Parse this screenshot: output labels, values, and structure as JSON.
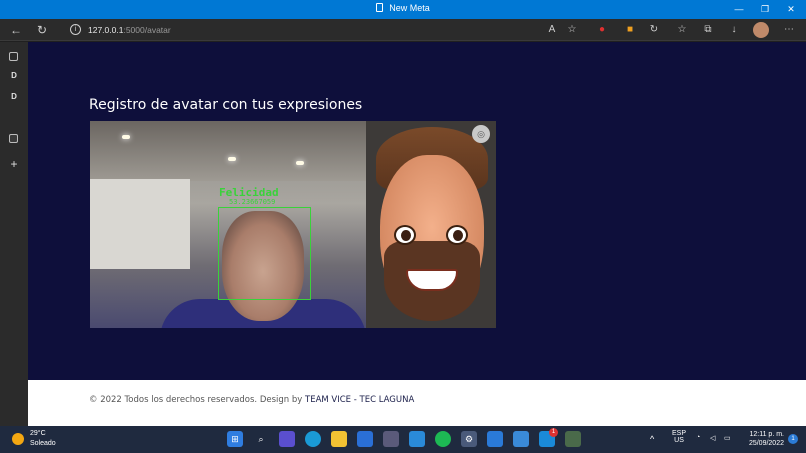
{
  "window": {
    "title": "New Meta",
    "minimize": "—",
    "maximize": "❐",
    "close": "✕"
  },
  "browser": {
    "url_host": "127.0.0.1",
    "url_path": ":5000/avatar",
    "back": "←",
    "refresh": "↻",
    "info": "i"
  },
  "sidebar": {
    "items": [
      {
        "label": "D"
      },
      {
        "label": "D"
      },
      {
        "label": "+"
      }
    ]
  },
  "page": {
    "title": "Registro de avatar con tus expresiones",
    "detection": {
      "emotion": "Felicidad",
      "confidence": "53.23667059"
    },
    "footer": {
      "text": "© 2022 Todos los derechos reservados. Design by ",
      "brand": "TEAM VICE - TEC LAGUNA"
    }
  },
  "taskbar": {
    "weather": {
      "temp": "29°C",
      "condition": "Soleado"
    },
    "lang": "ESP",
    "region": "US",
    "time": "12:11 p. m.",
    "date": "25/09/2022",
    "notifications": "1",
    "badge_skype": "1"
  },
  "colors": {
    "titlebar": "#0078d4",
    "page_bg": "#0e0f3b",
    "detection_green": "#3ad23a",
    "taskbar": "#1f2a3f"
  }
}
